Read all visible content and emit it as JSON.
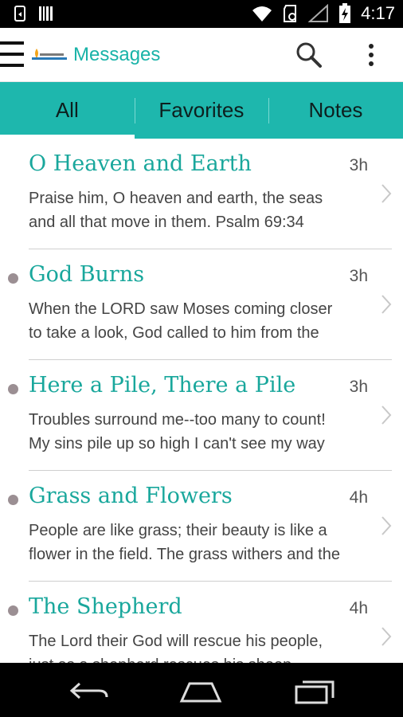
{
  "status_bar": {
    "time": "4:17",
    "icons": [
      "usb-debug-icon",
      "barcode-icon",
      "wifi-icon",
      "sd-card-icon",
      "signal-icon",
      "battery-charging-icon"
    ]
  },
  "app_bar": {
    "title": "Messages",
    "logo_name": "app-logo",
    "actions": [
      "search-icon",
      "overflow-menu-icon"
    ]
  },
  "tabs": [
    {
      "label": "All",
      "active": true
    },
    {
      "label": "Favorites",
      "active": false
    },
    {
      "label": "Notes",
      "active": false
    }
  ],
  "messages": [
    {
      "title": "O Heaven and Earth",
      "time": "3h",
      "unread": false,
      "line1": "Praise him, O heaven and earth, the seas",
      "line2": "and all that move in them. Psalm 69:34"
    },
    {
      "title": "God Burns",
      "time": "3h",
      "unread": true,
      "line1": "When the LORD saw Moses coming closer",
      "line2": "to take a look, God called to him from the"
    },
    {
      "title": "Here a Pile, There a Pile",
      "time": "3h",
      "unread": true,
      "line1": "Troubles surround me--too many to count!",
      "line2": "My sins pile up so high I can't see my way"
    },
    {
      "title": "Grass and Flowers",
      "time": "4h",
      "unread": true,
      "line1": "People are like grass; their beauty is like a",
      "line2": "flower in the field. The grass withers and the"
    },
    {
      "title": "The Shepherd",
      "time": "4h",
      "unread": true,
      "line1": "The Lord their God will rescue his people,",
      "line2": "just as a shepherd rescues his sheep"
    }
  ],
  "colors": {
    "accent": "#1eb7ad",
    "title": "#19a79c",
    "unread_dot": "#9b8f93"
  }
}
